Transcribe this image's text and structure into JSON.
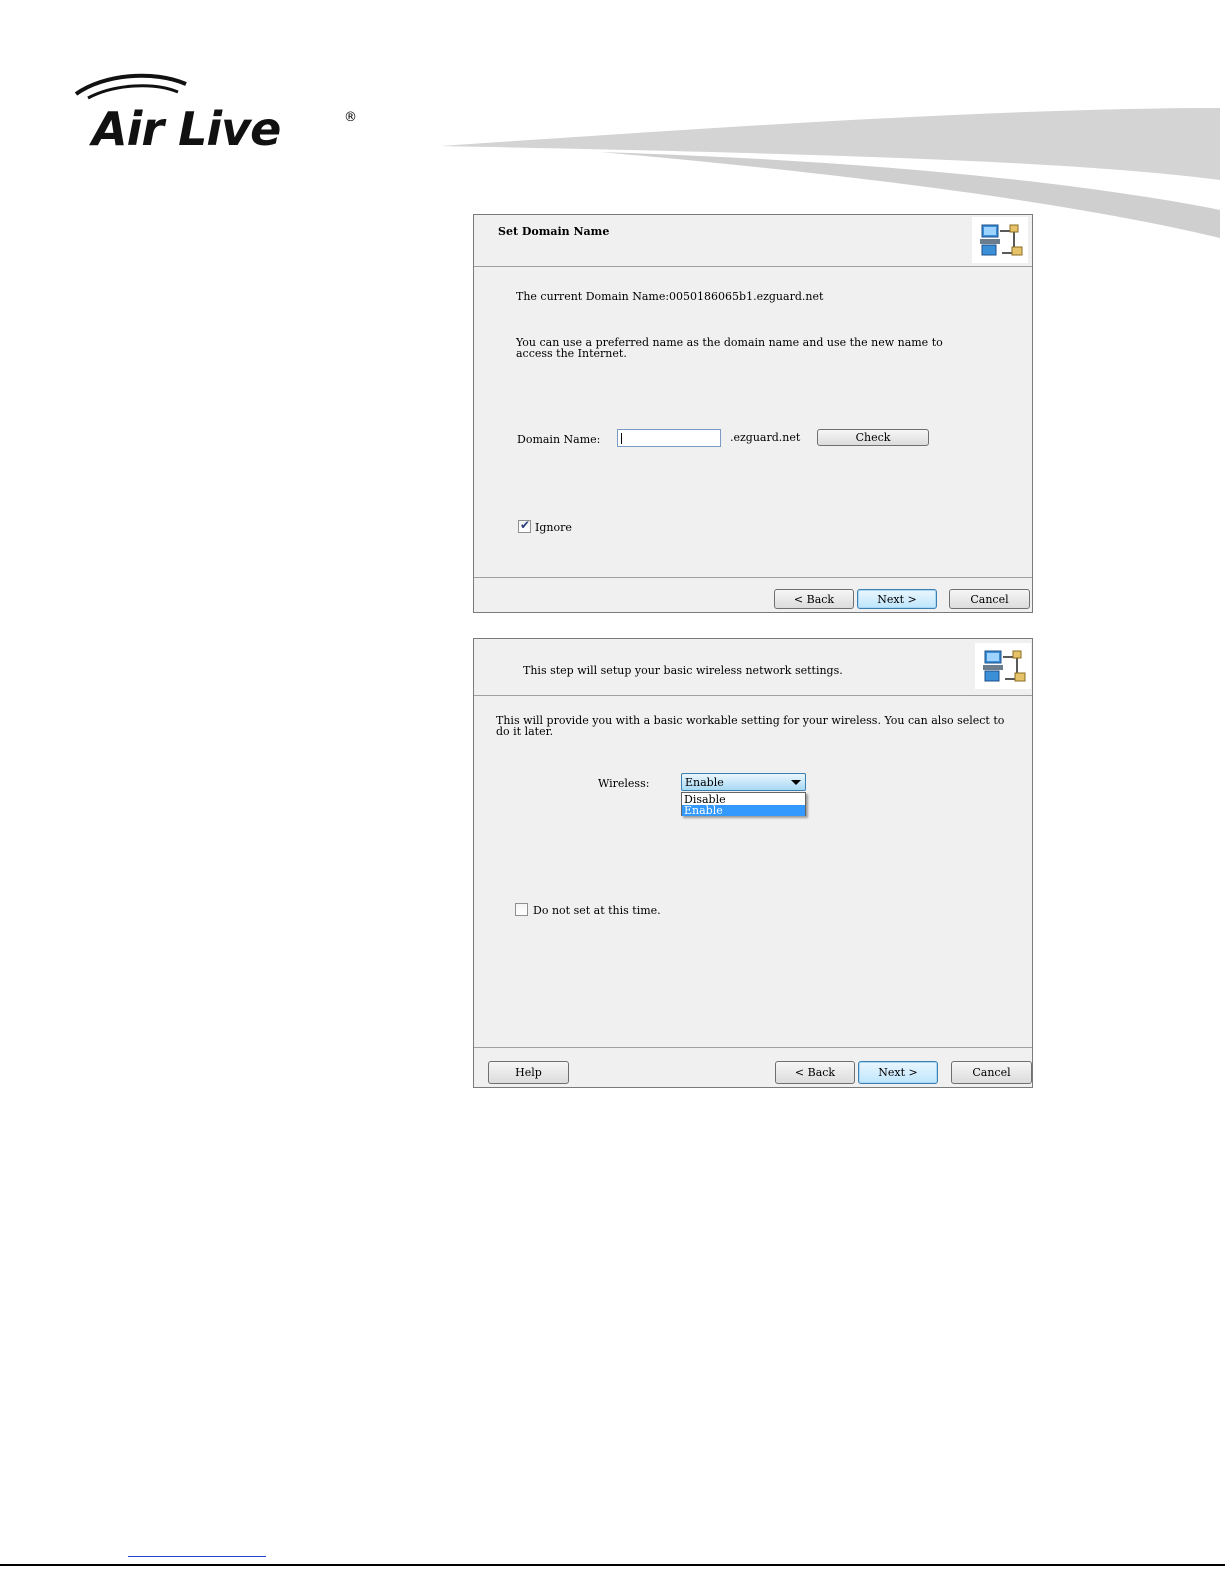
{
  "brand": {
    "logo_text": "Air Live",
    "registered": "®"
  },
  "dialog1": {
    "title": "Set Domain Name",
    "current_domain": "The current Domain Name:0050186065b1.ezguard.net",
    "description": "You can use a preferred name as the domain name and use the new name to access the Internet.",
    "domain_label": "Domain Name:",
    "domain_value": "",
    "domain_suffix": ".ezguard.net",
    "check_label": "Check",
    "ignore_label": "Ignore",
    "ignore_checked": true,
    "back_label": "< Back",
    "next_label": "Next >",
    "cancel_label": "Cancel"
  },
  "dialog2": {
    "header_text": "This step will setup your basic wireless network settings.",
    "description": "This will provide you with a basic workable setting for your wireless. You can also select to do it later.",
    "wireless_label": "Wireless:",
    "wireless_value": "Enable",
    "wireless_options": [
      "Disable",
      "Enable"
    ],
    "wireless_selected": "Enable",
    "donot_label": "Do not set at this time.",
    "donot_checked": false,
    "help_label": "Help",
    "back_label": "< Back",
    "next_label": "Next >",
    "cancel_label": "Cancel"
  }
}
